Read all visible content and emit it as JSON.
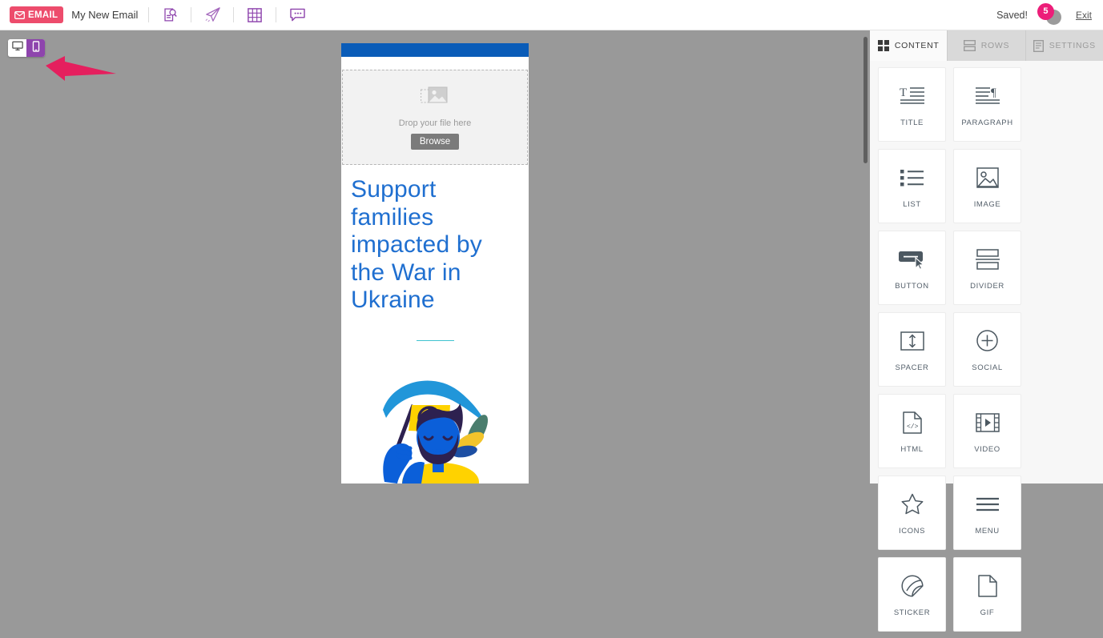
{
  "topbar": {
    "brand_label": "EMAIL",
    "brand_color": "#ed4c6c",
    "doc_title": "My New Email",
    "tools": [
      {
        "name": "preview-icon",
        "title": "Preview"
      },
      {
        "name": "send-test-icon",
        "title": "Send test"
      },
      {
        "name": "grid-icon",
        "title": "Grid"
      },
      {
        "name": "comments-icon",
        "title": "Comments"
      }
    ],
    "saved_label": "Saved!",
    "notification_count": "5",
    "notification_color": "#ec1e79",
    "exit_label": "Exit"
  },
  "canvas": {
    "device_toggle": {
      "desktop_label": "Desktop",
      "mobile_label": "Mobile",
      "active": "mobile",
      "active_color": "#8e44ad"
    },
    "annotation": {
      "type": "arrow",
      "color": "#e51f5e",
      "points_to": "mobile-view-button"
    },
    "background_color": "#999999"
  },
  "email": {
    "header_bar_color": "#0a5cb8",
    "dropzone": {
      "text": "Drop your file here",
      "button_label": "Browse"
    },
    "headline": "Support families impacted by the War in Ukraine",
    "headline_color": "#1f6fd0",
    "divider_color": "#3fc3d0",
    "illustration": {
      "name": "ukraine-peace-illustration",
      "colors": {
        "arc_blue": "#2196d9",
        "flag_yellow": "#ffd200",
        "skin_blue": "#0b5fd9",
        "hair_navy": "#2d2150",
        "leaf_green": "#4a7d6d",
        "leaf_yellow": "#f2c42b"
      }
    }
  },
  "panel": {
    "tabs": [
      {
        "label": "CONTENT",
        "icon": "grid-4-icon",
        "active": true
      },
      {
        "label": "ROWS",
        "icon": "rows-icon",
        "active": false
      },
      {
        "label": "SETTINGS",
        "icon": "settings-doc-icon",
        "active": false
      }
    ],
    "blocks": [
      {
        "label": "TITLE",
        "icon": "title-icon"
      },
      {
        "label": "PARAGRAPH",
        "icon": "paragraph-icon"
      },
      {
        "label": "LIST",
        "icon": "list-icon"
      },
      {
        "label": "IMAGE",
        "icon": "image-icon"
      },
      {
        "label": "BUTTON",
        "icon": "button-icon"
      },
      {
        "label": "DIVIDER",
        "icon": "divider-icon"
      },
      {
        "label": "SPACER",
        "icon": "spacer-icon"
      },
      {
        "label": "SOCIAL",
        "icon": "social-plus-icon"
      },
      {
        "label": "HTML",
        "icon": "html-code-icon"
      },
      {
        "label": "VIDEO",
        "icon": "video-icon"
      },
      {
        "label": "ICONS",
        "icon": "star-icon"
      },
      {
        "label": "MENU",
        "icon": "menu-hamburger-icon"
      },
      {
        "label": "STICKER",
        "icon": "sticker-icon"
      },
      {
        "label": "GIF",
        "icon": "gif-page-icon"
      }
    ]
  }
}
